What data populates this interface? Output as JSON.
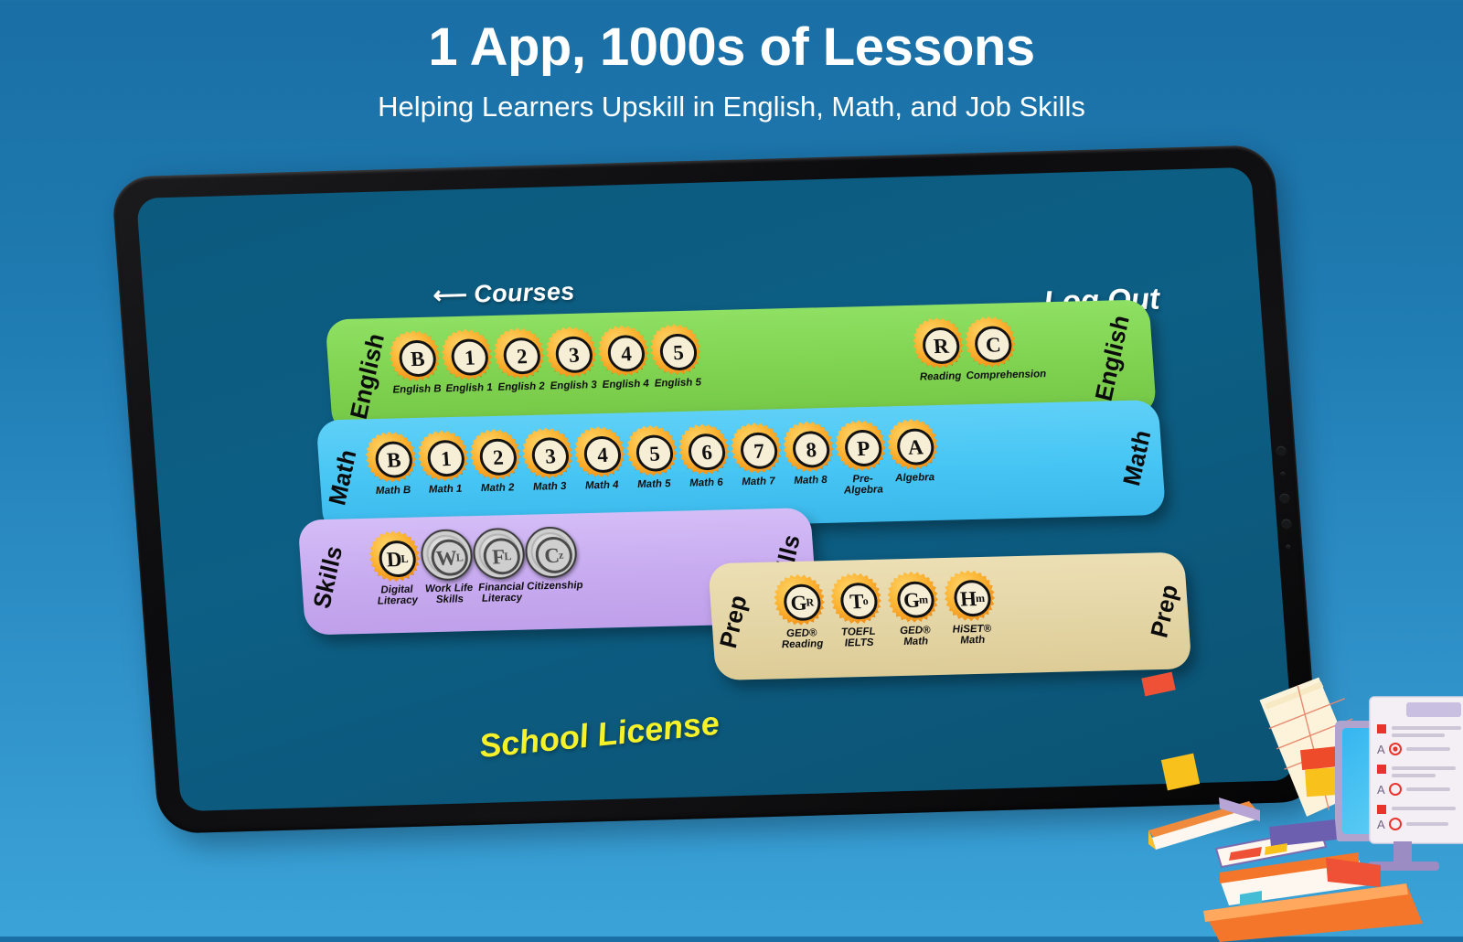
{
  "hero": {
    "title": "1 App, 1000s of Lessons",
    "subtitle": "Helping Learners Upskill in English, Math, and Job Skills"
  },
  "screen": {
    "back_link": "Courses",
    "back_arrow": "back-arrow-icon",
    "logout": "Log Out",
    "license": "School License",
    "background_color": "#0c5a7e"
  },
  "colors": {
    "page_gradient_top": "#1a6fa5",
    "page_gradient_bottom": "#3ba3d8",
    "english_row": "#7fd24f",
    "math_row": "#46c5f4",
    "skills_row": "#c7aaef",
    "prep_row": "#e4d5a5",
    "medal_unlocked": "#fcb534",
    "medal_locked": "#c9c9c9",
    "license_text": "#f5f12a"
  },
  "rows": [
    {
      "id": "english",
      "label": "English",
      "end_label": "English",
      "badges": [
        {
          "glyph": "B",
          "sub": "",
          "caption": "English B",
          "locked": false
        },
        {
          "glyph": "1",
          "sub": "",
          "caption": "English 1",
          "locked": false
        },
        {
          "glyph": "2",
          "sub": "",
          "caption": "English 2",
          "locked": false
        },
        {
          "glyph": "3",
          "sub": "",
          "caption": "English 3",
          "locked": false
        },
        {
          "glyph": "4",
          "sub": "",
          "caption": "English 4",
          "locked": false
        },
        {
          "glyph": "5",
          "sub": "",
          "caption": "English 5",
          "locked": false
        },
        {
          "glyph": "R",
          "sub": "",
          "caption": "Reading",
          "locked": false
        },
        {
          "glyph": "C",
          "sub": "",
          "caption": "Comprehension",
          "locked": false
        }
      ]
    },
    {
      "id": "math",
      "label": "Math",
      "end_label": "Math",
      "badges": [
        {
          "glyph": "B",
          "sub": "",
          "caption": "Math B",
          "locked": false
        },
        {
          "glyph": "1",
          "sub": "",
          "caption": "Math 1",
          "locked": false
        },
        {
          "glyph": "2",
          "sub": "",
          "caption": "Math 2",
          "locked": false
        },
        {
          "glyph": "3",
          "sub": "",
          "caption": "Math 3",
          "locked": false
        },
        {
          "glyph": "4",
          "sub": "",
          "caption": "Math 4",
          "locked": false
        },
        {
          "glyph": "5",
          "sub": "",
          "caption": "Math 5",
          "locked": false
        },
        {
          "glyph": "6",
          "sub": "",
          "caption": "Math 6",
          "locked": false
        },
        {
          "glyph": "7",
          "sub": "",
          "caption": "Math 7",
          "locked": false
        },
        {
          "glyph": "8",
          "sub": "",
          "caption": "Math 8",
          "locked": false
        },
        {
          "glyph": "P",
          "sub": "",
          "caption": "Pre-Algebra",
          "locked": false
        },
        {
          "glyph": "A",
          "sub": "",
          "caption": "Algebra",
          "locked": false
        }
      ]
    },
    {
      "id": "skills",
      "label": "Skills",
      "end_label": "Skills",
      "badges": [
        {
          "glyph": "D",
          "sub": "L",
          "caption": "Digital\nLiteracy",
          "locked": false
        },
        {
          "glyph": "W",
          "sub": "L",
          "caption": "Work Life\nSkills",
          "locked": true
        },
        {
          "glyph": "F",
          "sub": "L",
          "caption": "Financial\nLiteracy",
          "locked": true
        },
        {
          "glyph": "C",
          "sub": "z",
          "caption": "Citizenship",
          "locked": true
        }
      ]
    },
    {
      "id": "prep",
      "label": "Prep",
      "end_label": "Prep",
      "badges": [
        {
          "glyph": "G",
          "sub": "R",
          "caption": "GED®\nReading",
          "locked": false
        },
        {
          "glyph": "T",
          "sub": "o",
          "caption": "TOEFL\nIELTS",
          "locked": false
        },
        {
          "glyph": "G",
          "sub": "m",
          "caption": "GED®\nMath",
          "locked": false
        },
        {
          "glyph": "H",
          "sub": "m",
          "caption": "HiSET®\nMath",
          "locked": false
        }
      ]
    }
  ],
  "illustration": {
    "name": "study-desk-illustration",
    "items": [
      "monitor-quiz-screen",
      "stacked-books",
      "notepaper",
      "sticky-notes"
    ]
  }
}
